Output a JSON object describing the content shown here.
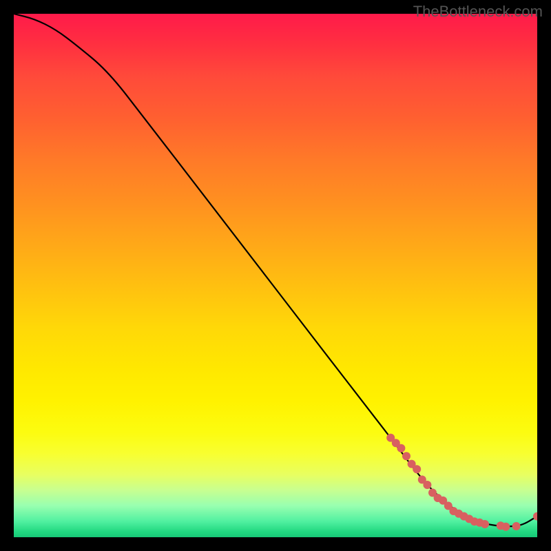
{
  "watermark": "TheBottleneck.com",
  "chart_data": {
    "type": "line",
    "title": "",
    "xlabel": "",
    "ylabel": "",
    "xlim": [
      0,
      100
    ],
    "ylim": [
      0,
      100
    ],
    "series": [
      {
        "name": "curve",
        "x": [
          0,
          4,
          8,
          12,
          18,
          25,
          35,
          45,
          55,
          65,
          72,
          78,
          82,
          86,
          90,
          94,
          97,
          100
        ],
        "y": [
          100,
          99,
          97,
          94,
          89,
          80,
          67,
          54,
          41,
          28,
          19,
          11,
          7,
          4,
          2.5,
          2,
          2.2,
          4
        ],
        "color": "#000000",
        "style": "line"
      },
      {
        "name": "highlight-points",
        "x": [
          72,
          73,
          74,
          75,
          76,
          77,
          78,
          79,
          80,
          81,
          82,
          83,
          84,
          85,
          86,
          87,
          88,
          89,
          90,
          93,
          94,
          96,
          100
        ],
        "y": [
          19,
          18,
          17,
          15.5,
          14,
          13,
          11,
          10,
          8.5,
          7.5,
          7,
          6,
          5,
          4.5,
          4,
          3.5,
          3,
          2.8,
          2.5,
          2.2,
          2,
          2.1,
          4
        ],
        "color": "#d86060",
        "style": "scatter"
      }
    ],
    "background": "gradient-red-yellow-green",
    "grid": false,
    "legend": false
  }
}
